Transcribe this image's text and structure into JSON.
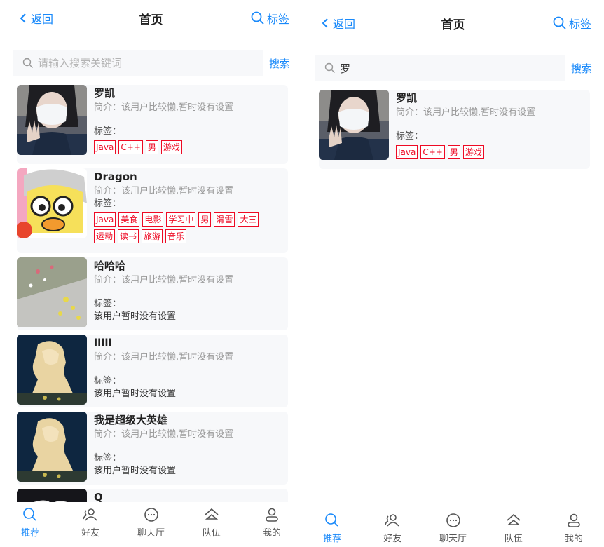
{
  "left": {
    "navbar": {
      "back_label": "返回",
      "title": "首页",
      "tag_label": "标签"
    },
    "search": {
      "placeholder": "请输入搜索关键词",
      "value": "",
      "button_label": "搜索"
    },
    "users": [
      {
        "name": "罗凯",
        "desc": "简介：该用户比较懒,暂时没有设置",
        "tag_label": "标签：",
        "tags": [
          "Java",
          "C++",
          "男",
          "游戏"
        ],
        "avatar_icon": "avatar-photo-masked-person"
      },
      {
        "name": "Dragon",
        "desc": "简介：该用户比较懒,暂时没有设置",
        "tag_label": "标签：",
        "tags": [
          "Java",
          "美食",
          "电影",
          "学习中",
          "男",
          "滑雪",
          "大三",
          "运动",
          "读书",
          "旅游",
          "音乐"
        ],
        "avatar_icon": "avatar-cartoon-duck"
      },
      {
        "name": "哈哈哈",
        "desc": "简介：该用户比较懒,暂时没有设置",
        "tag_label": "标签：",
        "tags": [],
        "no_tags": "该用户暂时没有设置",
        "avatar_icon": "avatar-photo-flowers"
      },
      {
        "name": "lllll",
        "desc": "简介：该用户比较懒,暂时没有设置",
        "tag_label": "标签：",
        "tags": [],
        "no_tags": "该用户暂时没有设置",
        "avatar_icon": "avatar-photo-statue"
      },
      {
        "name": "我是超级大英雄",
        "desc": "简介：该用户比较懒,暂时没有设置",
        "tag_label": "标签：",
        "tags": [],
        "no_tags": "该用户暂时没有设置",
        "avatar_icon": "avatar-photo-statue"
      },
      {
        "name": "Q",
        "desc": "",
        "tag_label": "",
        "tags": [],
        "avatar_icon": "avatar-photo-anime"
      }
    ],
    "tabbar": [
      {
        "label": "推荐",
        "icon": "search-icon",
        "active": true
      },
      {
        "label": "好友",
        "icon": "friends-icon",
        "active": false
      },
      {
        "label": "聊天厅",
        "icon": "chat-icon",
        "active": false
      },
      {
        "label": "队伍",
        "icon": "home-icon",
        "active": false
      },
      {
        "label": "我的",
        "icon": "user-icon",
        "active": false
      }
    ]
  },
  "right": {
    "navbar": {
      "back_label": "返回",
      "title": "首页",
      "tag_label": "标签"
    },
    "search": {
      "placeholder": "请输入搜索关键词",
      "value": "罗",
      "button_label": "搜索"
    },
    "users": [
      {
        "name": "罗凯",
        "desc": "简介：该用户比较懒,暂时没有设置",
        "tag_label": "标签：",
        "tags": [
          "Java",
          "C++",
          "男",
          "游戏"
        ],
        "avatar_icon": "avatar-photo-masked-person"
      }
    ],
    "tabbar": [
      {
        "label": "推荐",
        "icon": "search-icon",
        "active": true
      },
      {
        "label": "好友",
        "icon": "friends-icon",
        "active": false
      },
      {
        "label": "聊天厅",
        "icon": "chat-icon",
        "active": false
      },
      {
        "label": "队伍",
        "icon": "home-icon",
        "active": false
      },
      {
        "label": "我的",
        "icon": "user-icon",
        "active": false
      }
    ]
  },
  "colors": {
    "primary": "#1989fa",
    "tag": "#ee0a24",
    "card_bg": "#f7f8fa",
    "muted": "#999999"
  }
}
